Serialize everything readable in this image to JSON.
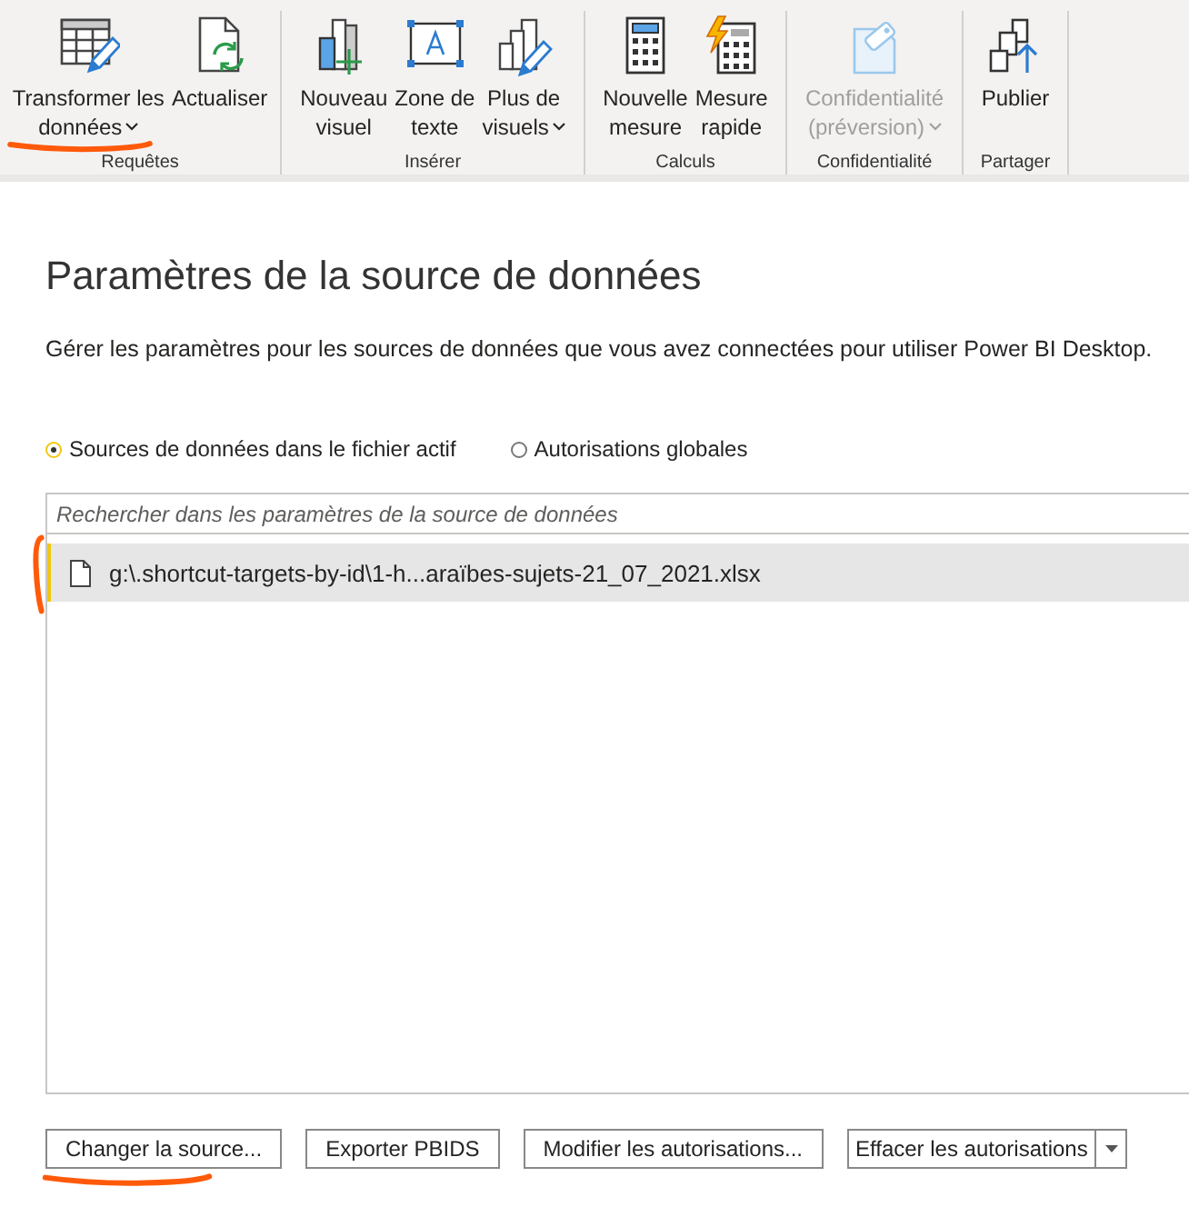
{
  "ribbon": {
    "groups": [
      {
        "label": "Requêtes",
        "buttons": [
          {
            "kind": "table-edit",
            "lines": [
              "Transformer les",
              "données"
            ],
            "dropdown": true,
            "disabled": false,
            "marked": true
          },
          {
            "kind": "refresh",
            "lines": [
              "Actualiser"
            ],
            "dropdown": false,
            "disabled": false,
            "marked": false
          }
        ]
      },
      {
        "label": "Insérer",
        "buttons": [
          {
            "kind": "new-visual",
            "lines": [
              "Nouveau",
              "visuel"
            ],
            "dropdown": false,
            "disabled": false,
            "marked": false
          },
          {
            "kind": "text-box",
            "lines": [
              "Zone de",
              "texte"
            ],
            "dropdown": false,
            "disabled": false,
            "marked": false
          },
          {
            "kind": "more-visuals",
            "lines": [
              "Plus de",
              "visuels"
            ],
            "dropdown": true,
            "disabled": false,
            "marked": false
          }
        ]
      },
      {
        "label": "Calculs",
        "buttons": [
          {
            "kind": "calculator",
            "lines": [
              "Nouvelle",
              "mesure"
            ],
            "dropdown": false,
            "disabled": false,
            "marked": false
          },
          {
            "kind": "quick-measure",
            "lines": [
              "Mesure",
              "rapide"
            ],
            "dropdown": false,
            "disabled": false,
            "marked": false
          }
        ]
      },
      {
        "label": "Confidentialité",
        "buttons": [
          {
            "kind": "sensitivity",
            "lines": [
              "Confidentialité",
              "(préversion)"
            ],
            "dropdown": true,
            "disabled": true,
            "marked": false
          }
        ]
      },
      {
        "label": "Partager",
        "buttons": [
          {
            "kind": "publish",
            "lines": [
              "Publier"
            ],
            "dropdown": false,
            "disabled": false,
            "marked": false
          }
        ]
      }
    ]
  },
  "dialog": {
    "title": "Paramètres de la source de données",
    "description": "Gérer les paramètres pour les sources de données que vous avez connectées pour utiliser Power BI Desktop.",
    "scopes": [
      {
        "label": "Sources de données dans le fichier actif",
        "selected": true
      },
      {
        "label": "Autorisations globales",
        "selected": false
      }
    ],
    "search": {
      "placeholder": "Rechercher dans les paramètres de la source de données"
    },
    "sources": [
      {
        "path": "g:\\.shortcut-targets-by-id\\1-h...araïbes-sujets-21_07_2021.xlsx",
        "selected": true,
        "marked": true
      }
    ],
    "buttons": [
      {
        "kind": "button",
        "label": "Changer la source...",
        "marked": true
      },
      {
        "kind": "button",
        "label": "Exporter PBIDS",
        "marked": false
      },
      {
        "kind": "button",
        "label": "Modifier les autorisations...",
        "marked": false
      },
      {
        "kind": "split",
        "label": "Effacer les autorisations",
        "marked": false
      }
    ]
  }
}
